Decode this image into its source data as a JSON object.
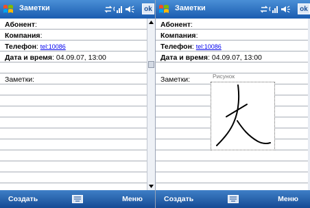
{
  "screens": [
    {
      "title": "Заметки",
      "ok_label": "ok",
      "fields": [
        {
          "label": "Абонент",
          "suffix": ":"
        },
        {
          "label": "Компания",
          "suffix": ":"
        },
        {
          "label": "Телефон",
          "suffix": ":",
          "link": "tel:10086"
        },
        {
          "label": "Дата и время",
          "suffix": ":",
          "value": "04.09.07, 13:00"
        }
      ],
      "notes_label": "Заметки:",
      "softkeys": {
        "left": "Создать",
        "right": "Меню"
      }
    },
    {
      "title": "Заметки",
      "ok_label": "ok",
      "fields": [
        {
          "label": "Абонент",
          "suffix": ":"
        },
        {
          "label": "Компания",
          "suffix": ":"
        },
        {
          "label": "Телефон",
          "suffix": ":",
          "link": "tel:10086"
        },
        {
          "label": "Дата и время",
          "suffix": ":",
          "value": "04.09.07, 13:00"
        }
      ],
      "notes_label": "Заметки:",
      "drawing_label": "Рисунок",
      "softkeys": {
        "left": "Создать",
        "right": "Меню"
      }
    }
  ],
  "colors": {
    "titlebar": "#1a5cb0",
    "softbar": "#154a94",
    "link": "#0000ee",
    "ruled_line": "#a7adb6"
  },
  "icons": [
    "windows-start-icon",
    "sync-icon",
    "signal-icon",
    "volume-icon",
    "keyboard-icon",
    "scroll-up-icon",
    "scroll-down-icon"
  ]
}
